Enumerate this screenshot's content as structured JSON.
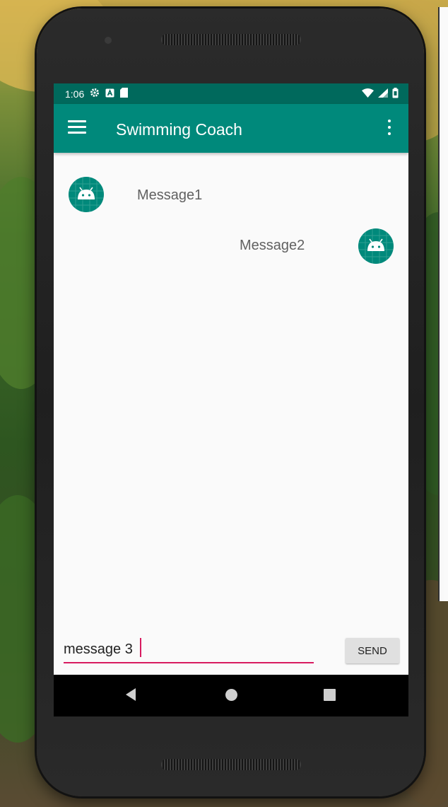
{
  "status_bar": {
    "time": "1:06",
    "icons": [
      "settings-icon",
      "notification-a-icon",
      "sd-card-icon"
    ],
    "right_icons": [
      "wifi-icon",
      "signal-icon",
      "battery-icon"
    ]
  },
  "toolbar": {
    "title": "Swimming Coach",
    "menu_icon": "hamburger-menu-icon",
    "overflow_icon": "more-vert-icon"
  },
  "messages": [
    {
      "text": "Message1",
      "side": "left",
      "avatar": "android-avatar-icon"
    },
    {
      "text": "Message2",
      "side": "right",
      "avatar": "android-avatar-icon"
    }
  ],
  "composer": {
    "value": "message 3",
    "send_label": "SEND"
  },
  "nav_bar": {
    "buttons": [
      "back-icon",
      "home-icon",
      "recents-icon"
    ]
  },
  "colors": {
    "primary": "#00897b",
    "primary_dark": "#00695c",
    "accent": "#d81b60"
  }
}
